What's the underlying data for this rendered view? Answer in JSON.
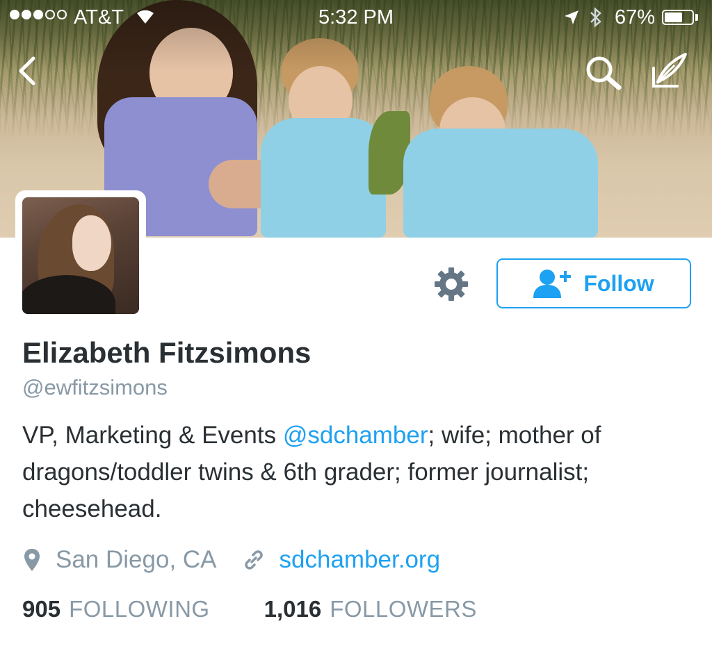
{
  "status_bar": {
    "carrier": "AT&T",
    "signal_bars_filled": 3,
    "signal_bars_total": 5,
    "time": "5:32 PM",
    "battery_percent": "67%",
    "battery_level": 0.67
  },
  "nav": {
    "back_icon": "chevron-left-icon",
    "search_icon": "search-icon",
    "compose_icon": "compose-icon"
  },
  "profile": {
    "display_name": "Elizabeth Fitzsimons",
    "screen_name": "@ewfitzsimons",
    "bio": {
      "before_mention": "VP, Marketing & Events ",
      "mention": "@sdchamber",
      "after_mention": "; wife; mother of dragons/toddler twins & 6th grader; former journalist; cheesehead."
    },
    "location": "San Diego, CA",
    "website": "sdchamber.org"
  },
  "actions": {
    "follow_label": "Follow"
  },
  "stats": {
    "following_count": "905",
    "following_label": "FOLLOWING",
    "followers_count": "1,016",
    "followers_label": "FOLLOWERS"
  },
  "colors": {
    "accent": "#1da1f2",
    "secondary_text": "#8899a6",
    "primary_text": "#292f33",
    "icon_gray": "#657786"
  }
}
